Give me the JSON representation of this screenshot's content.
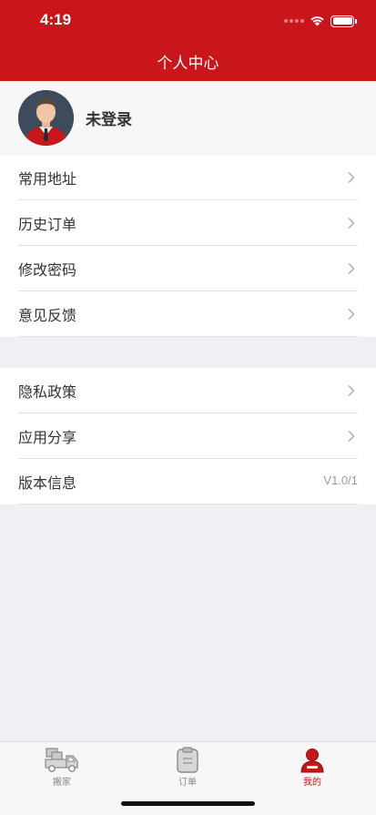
{
  "status_bar": {
    "time": "4:19"
  },
  "header": {
    "title": "个人中心"
  },
  "profile": {
    "name": "未登录"
  },
  "menu_group_1": [
    {
      "label": "常用地址"
    },
    {
      "label": "历史订单"
    },
    {
      "label": "修改密码"
    },
    {
      "label": "意见反馈"
    }
  ],
  "menu_group_2": [
    {
      "label": "隐私政策"
    },
    {
      "label": "应用分享"
    },
    {
      "label": "版本信息",
      "value": "V1.0/1"
    }
  ],
  "tabbar": {
    "items": [
      {
        "label": "搬家",
        "icon": "truck-icon"
      },
      {
        "label": "订单",
        "icon": "clipboard-icon"
      },
      {
        "label": "我的",
        "icon": "person-icon",
        "active": true
      }
    ]
  },
  "colors": {
    "brand": "#c8161a",
    "background": "#f0f0f4"
  }
}
